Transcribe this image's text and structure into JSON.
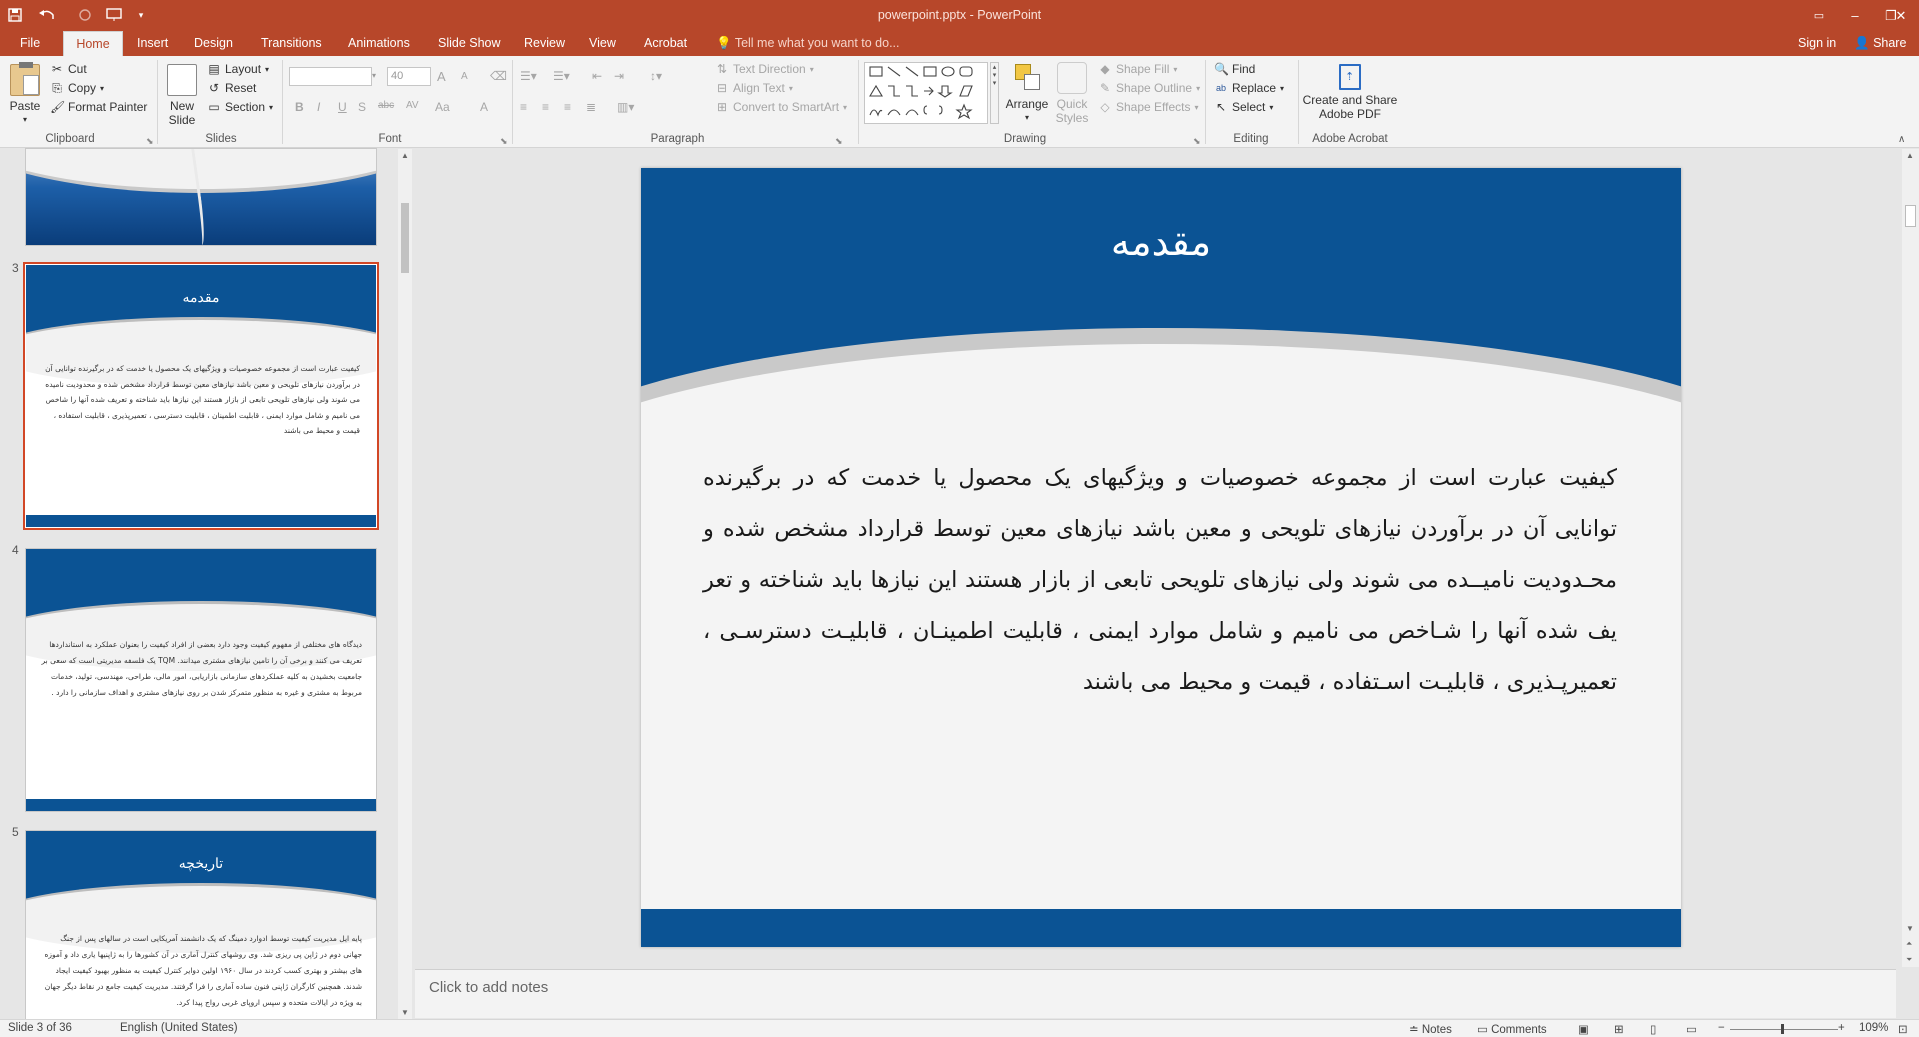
{
  "window": {
    "title": "powerpoint.pptx - PowerPoint",
    "sign_in": "Sign in",
    "share": "Share"
  },
  "tabs": [
    "File",
    "Home",
    "Insert",
    "Design",
    "Transitions",
    "Animations",
    "Slide Show",
    "Review",
    "View",
    "Acrobat"
  ],
  "active_tab": "Home",
  "tell_me": "Tell me what you want to do...",
  "ribbon": {
    "clipboard": {
      "paste": "Paste",
      "cut": "Cut",
      "copy": "Copy",
      "format_painter": "Format Painter",
      "label": "Clipboard"
    },
    "slides": {
      "new_slide_1": "New",
      "new_slide_2": "Slide",
      "layout": "Layout",
      "reset": "Reset",
      "section": "Section",
      "label": "Slides"
    },
    "font": {
      "font_name": "",
      "font_size": "40",
      "bold": "B",
      "italic": "I",
      "underline": "U",
      "shadow": "S",
      "strike": "abc",
      "spacing": "AV",
      "case": "Aa",
      "color": "A",
      "grow": "A",
      "shrink": "A",
      "label": "Font"
    },
    "paragraph": {
      "text_direction": "Text Direction",
      "align_text": "Align Text",
      "smartart": "Convert to SmartArt",
      "label": "Paragraph"
    },
    "drawing": {
      "arrange": "Arrange",
      "quick_styles_1": "Quick",
      "quick_styles_2": "Styles",
      "shape_fill": "Shape Fill",
      "shape_outline": "Shape Outline",
      "shape_effects": "Shape Effects",
      "label": "Drawing"
    },
    "editing": {
      "find": "Find",
      "replace": "Replace",
      "select": "Select",
      "label": "Editing"
    },
    "acrobat": {
      "create_1": "Create and Share",
      "create_2": "Adobe PDF",
      "label": "Adobe Acrobat"
    }
  },
  "thumbnails": [
    {
      "number": "",
      "title": ""
    },
    {
      "number": "3",
      "title": "مقدمه",
      "body": "کیفیت عبارت است از مجموعه خصوصیات و ویژگیهای یک محصول یا خدمت که در برگیرنده توانایی آن در برآوردن نیازهای تلویحی و معین باشد نیازهای معین توسط قرارداد مشخص شده و محدودیت نامیده می شوند ولی نیازهای تلویحی تابعی از بازار هستند این نیازها باید شناخته و تعریف شده آنها را شاخص می نامیم و شامل موارد ایمنی ، قابلیت اطمینان ، قابلیت دسترسی ، تعمیرپذیری ، قابلیت استفاده ، قیمت و محیط می باشند"
    },
    {
      "number": "4",
      "title": "",
      "body": "دیدگاه های مختلفی از مفهوم کیفیت وجود دارد بعضی از افراد کیفیت را بعنوان عملکرد به استانداردها تعریف می کنند و برخی آن را تامین نیازهای مشتری میدانند. TQM یک فلسفه مدیریتی است که سعی بر جامعیت بخشیدن به کلیه عملکردهای سازمانی بازاریابی، امور مالی، طراحی، مهندسی، تولید، خدمات مربوط به مشتری و غیره به منظور متمرکز شدن بر روی نیازهای مشتری و اهداف سازمانی را دارد ."
    },
    {
      "number": "5",
      "title": "تاریخچه",
      "body": "پایه ایل مدیریت کیفیت توسط ادوارد دمینگ که یک دانشمند آمریکایی است در سالهای پس از جنگ جهانی دوم در ژاپن پی ریزی شد. وی روشهای کنترل آماری در آن کشورها را به ژاپنیها یاری داد و آموزه های بیشتر و بهتری کسب کردند در سال ۱۹۶۰ اولین دوایر کنترل کیفیت به منظور بهبود کیفیت ایجاد شدند. همچنین کارگران ژاپنی فنون ساده آماری را فرا گرفتند. مدیریت کیفیت جامع در نقاط دیگر جهان به ویژه در ایالات متحده و سپس اروپای غربی رواج پیدا کرد."
    }
  ],
  "slide": {
    "title": "مقدمه",
    "body": "کیفیت عبارت است از مجموعه خصوصیات و ویژگیهای یک محصول یا خدمت که در برگیرنده توانایی آن در برآوردن نیازهای تلویحی و معین باشد نیازهای معین توسط قرارداد مشخص شده و محـدودیت نامیــده می شوند ولی نیازهای تلویحی تابعی از بازار هستند این نیازها باید شناخته و تعر یف شده آنها را شـاخص می نامیم و شامل موارد ایمنی ، قابلیت اطمینـان ، قابلیـت دسترسـی ، تعمیرپـذیری ، قابلیـت اسـتفاده ، قیمت و محیط می باشند"
  },
  "notes_placeholder": "Click to add notes",
  "status": {
    "slide_info": "Slide 3 of 36",
    "language": "English (United States)",
    "notes": "Notes",
    "comments": "Comments",
    "zoom": "109%"
  },
  "colors": {
    "accent": "#b7472a",
    "slide_blue": "#0b5394"
  }
}
